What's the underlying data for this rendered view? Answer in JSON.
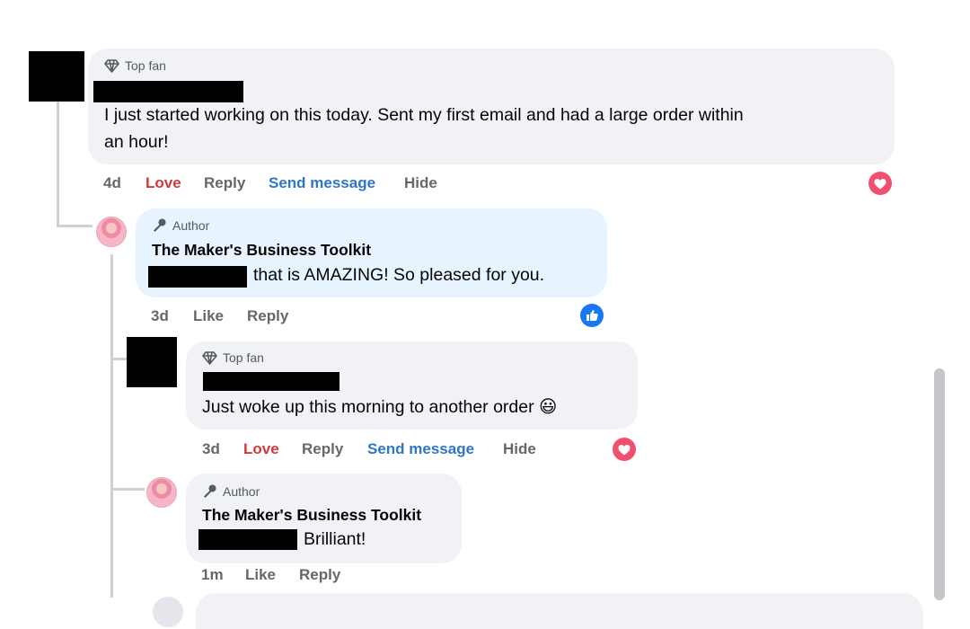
{
  "comments": [
    {
      "badge": "Top fan",
      "text_line1": "I just started working on this today. Sent my first email and had a large order within",
      "text_line2": "an hour!",
      "time": "4d",
      "reaction_label": "Love",
      "reply_label": "Reply",
      "send_label": "Send message",
      "hide_label": "Hide",
      "reaction_icon": "heart-icon"
    },
    {
      "badge": "Author",
      "name": "The Maker's Business Toolkit",
      "text": "that is AMAZING! So pleased for you.",
      "time": "3d",
      "like_label": "Like",
      "reply_label": "Reply",
      "reaction_icon": "like-icon"
    },
    {
      "badge": "Top fan",
      "text": "Just woke up this morning to another order 😃",
      "time": "3d",
      "reaction_label": "Love",
      "reply_label": "Reply",
      "send_label": "Send message",
      "hide_label": "Hide",
      "reaction_icon": "heart-icon"
    },
    {
      "badge": "Author",
      "name": "The Maker's Business Toolkit",
      "text": "Brilliant!",
      "time": "1m",
      "like_label": "Like",
      "reply_label": "Reply"
    }
  ],
  "colors": {
    "love": "#d13a3a",
    "send_message": "#2f76c6",
    "bubble": "#f0f2f5",
    "author_bubble": "#e7f3ff",
    "heart_reaction": "#f0506e",
    "like_reaction": "#1877f2"
  }
}
